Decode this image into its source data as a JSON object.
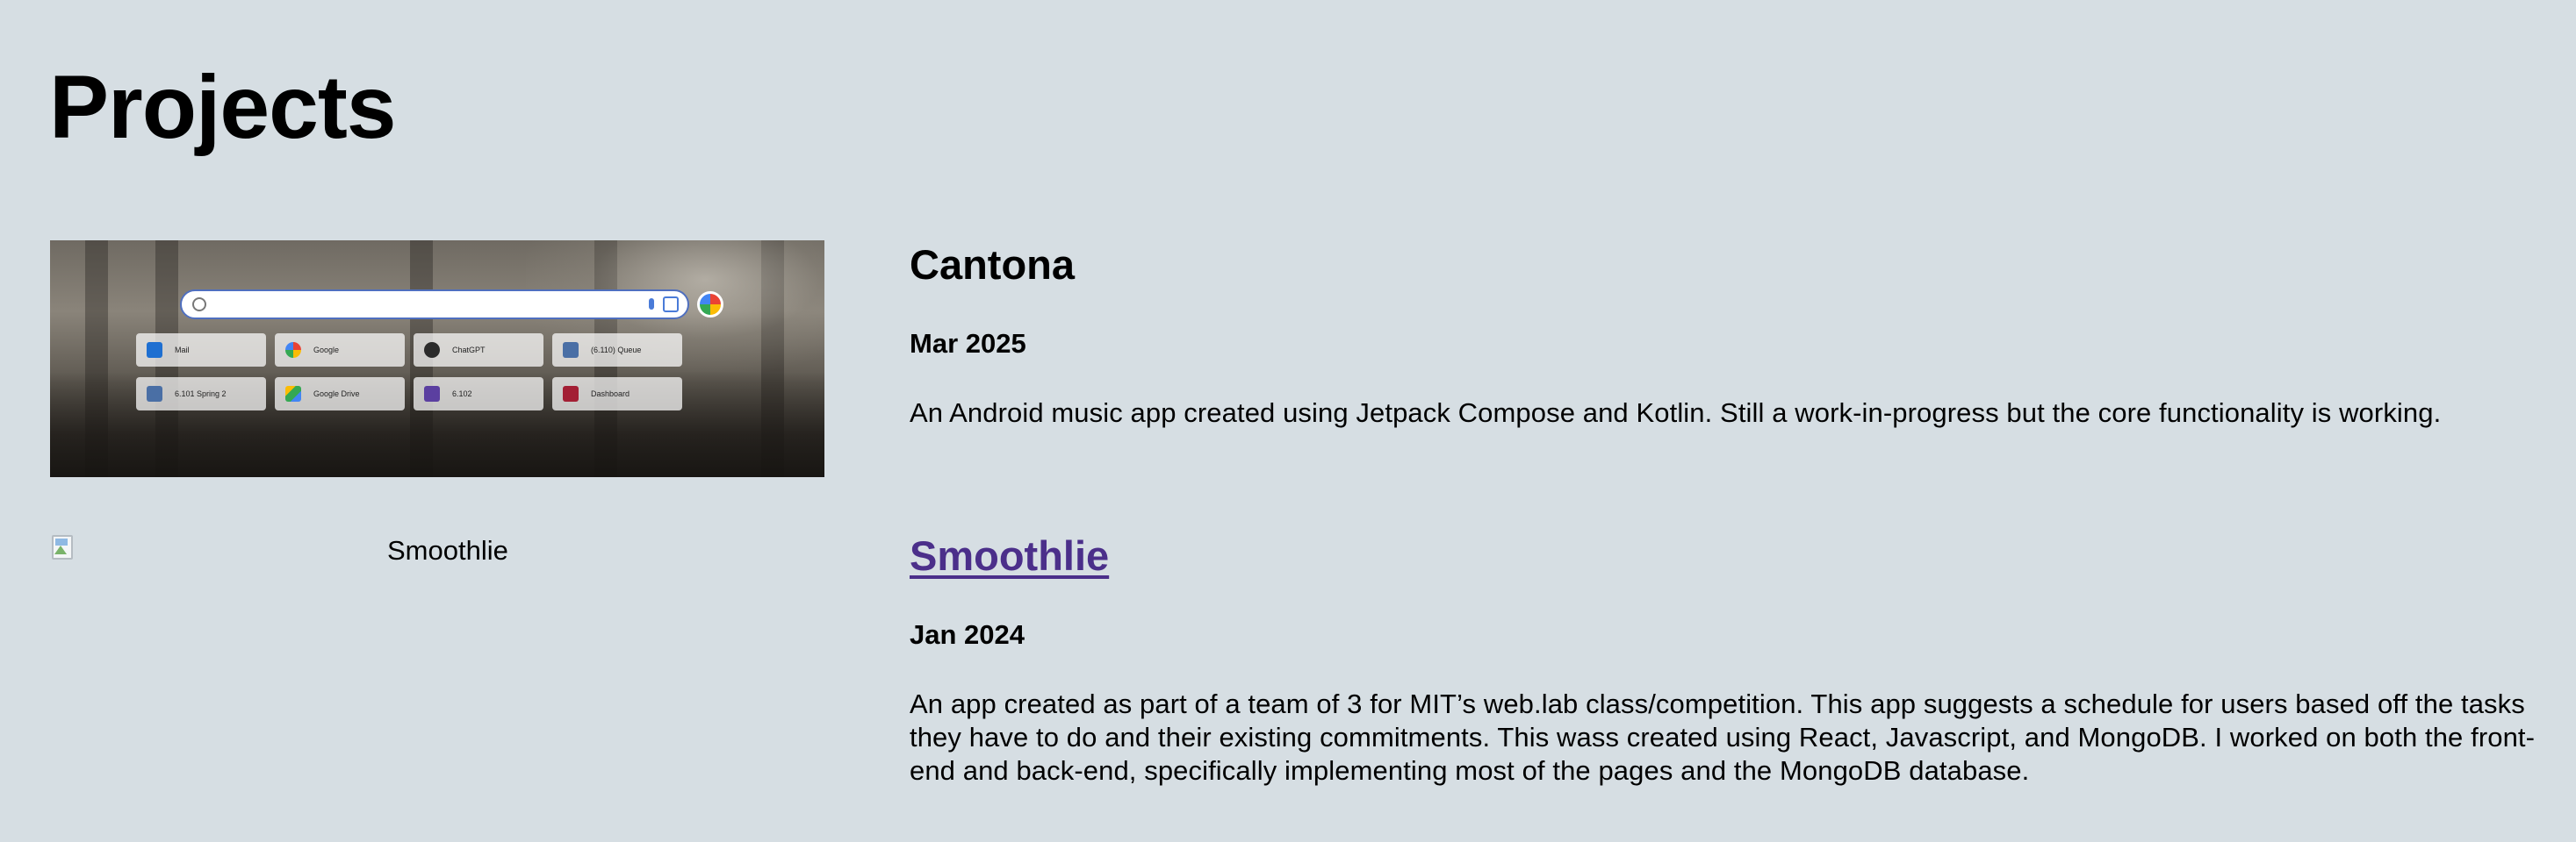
{
  "page": {
    "title": "Projects"
  },
  "projects": [
    {
      "title": "Cantona",
      "date": "Mar 2025",
      "description": "An Android music app created using Jetpack Compose and Kotlin. Still a work-in-progress but the core functionality is working.",
      "screenshot": {
        "shortcuts": [
          "Mail",
          "Google",
          "ChatGPT",
          "(6.110) Queue",
          "6.101 Spring 2",
          "Google Drive",
          "6.102",
          "Dashboard"
        ]
      }
    },
    {
      "title": "Smoothlie",
      "date": "Jan 2024",
      "description": "An app created as part of a team of 3 for MIT’s web.lab class/competition. This app suggests a schedule for users based off the tasks they have to do and their existing commitments. This wass created using React, Javascript, and MongoDB. I worked on both the front-end and back-end, specifically implementing most of the pages and the MongoDB database.",
      "image_alt": "Smoothlie"
    }
  ],
  "colors": {
    "background": "#d6dee3",
    "link": "#4b2f8a",
    "text": "#000000"
  },
  "icons": {
    "broken_image": "broken-image-icon",
    "search": "search-icon",
    "mic": "mic-icon",
    "lens": "lens-icon"
  }
}
